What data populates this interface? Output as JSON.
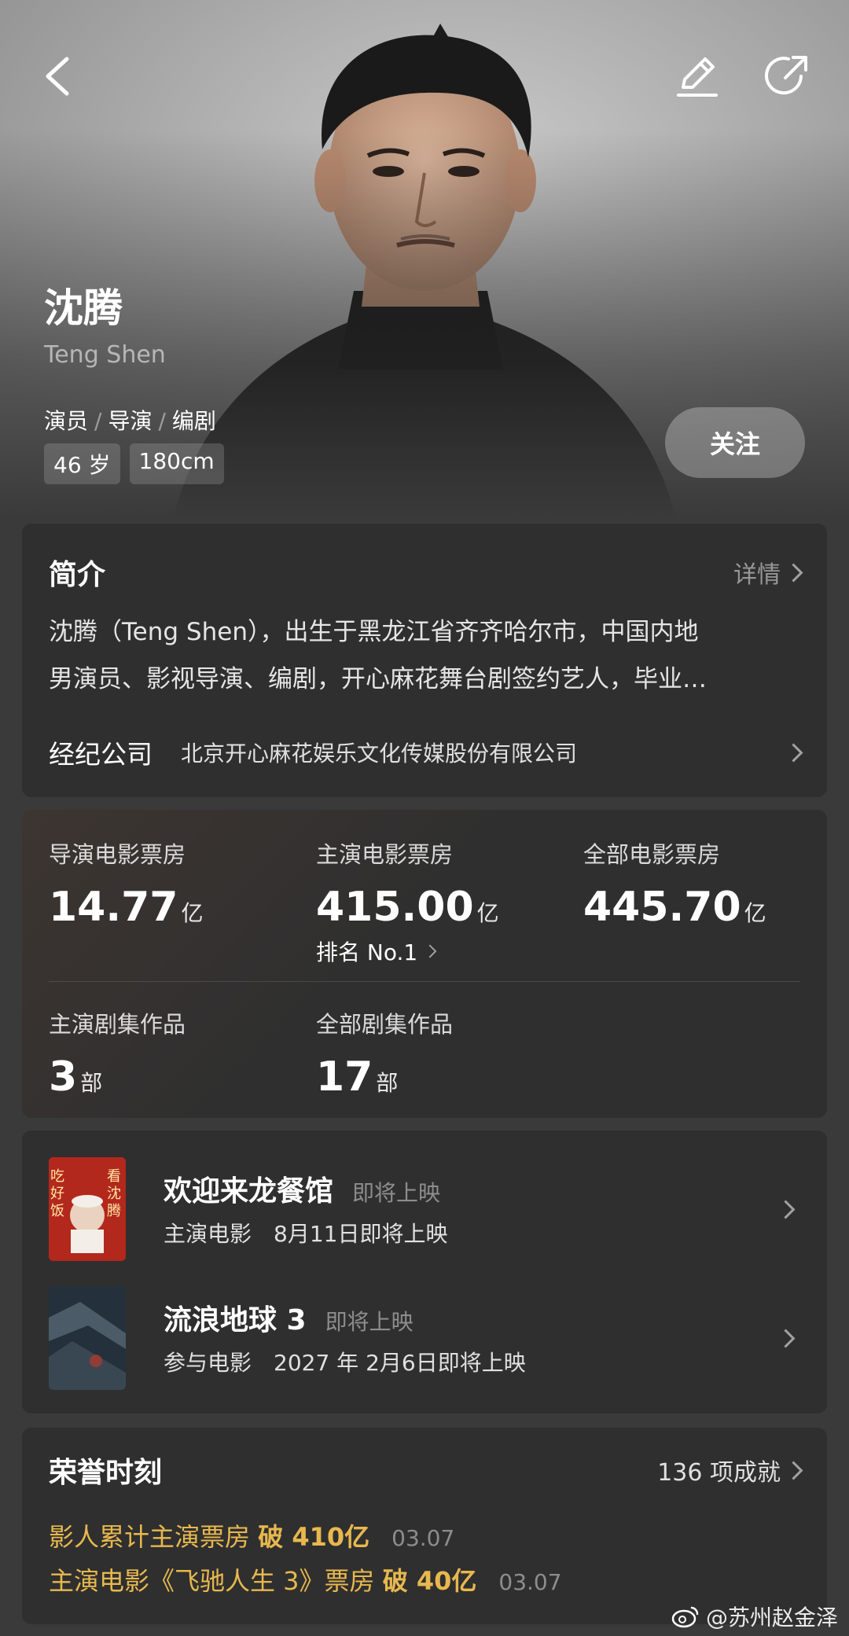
{
  "header": {
    "name": "沈腾",
    "english_name": "Teng Shen",
    "roles": [
      "演员",
      "导演",
      "编剧"
    ],
    "tags": [
      "46 岁",
      "180cm"
    ],
    "follow_label": "关注"
  },
  "intro": {
    "title": "简介",
    "details_label": "详情",
    "text_line1": "沈腾（Teng Shen），出生于黑龙江省齐齐哈尔市，中国内地",
    "text_line2": "男演员、影视导演、编剧，开心麻花舞台剧签约艺人，毕业…",
    "agency_label": "经纪公司",
    "agency_value": "北京开心麻花娱乐文化传媒股份有限公司"
  },
  "stats": {
    "director_box": {
      "label": "导演电影票房",
      "value": "14.77",
      "unit": "亿"
    },
    "lead_box": {
      "label": "主演电影票房",
      "value": "415.00",
      "unit": "亿",
      "rank": "排名 No.1"
    },
    "all_box": {
      "label": "全部电影票房",
      "value": "445.70",
      "unit": "亿"
    },
    "lead_series": {
      "label": "主演剧集作品",
      "value": "3",
      "unit": "部"
    },
    "all_series": {
      "label": "全部剧集作品",
      "value": "17",
      "unit": "部"
    }
  },
  "upcoming": [
    {
      "title": "欢迎来龙餐馆",
      "status": "即将上映",
      "type": "主演电影",
      "date": "8月11日即将上映",
      "poster_text": [
        "吃",
        "好",
        "饭",
        "看",
        "沈",
        "腾"
      ]
    },
    {
      "title": "流浪地球 3",
      "status": "即将上映",
      "type": "参与电影",
      "date": "2027 年 2月6日即将上映"
    }
  ],
  "honors": {
    "title": "荣誉时刻",
    "count_label": "136 项成就",
    "items": [
      {
        "prefix": "影人累计主演票房 ",
        "highlight": "破 410亿",
        "date": "03.07"
      },
      {
        "prefix": "主演电影《飞驰人生 3》票房 ",
        "highlight": "破 40亿",
        "date": "03.07"
      }
    ]
  },
  "watermark": "@苏州赵金泽",
  "colors": {
    "gold": "#e8b84e",
    "card": "#2f2f2f",
    "background": "#3a3a3a"
  }
}
